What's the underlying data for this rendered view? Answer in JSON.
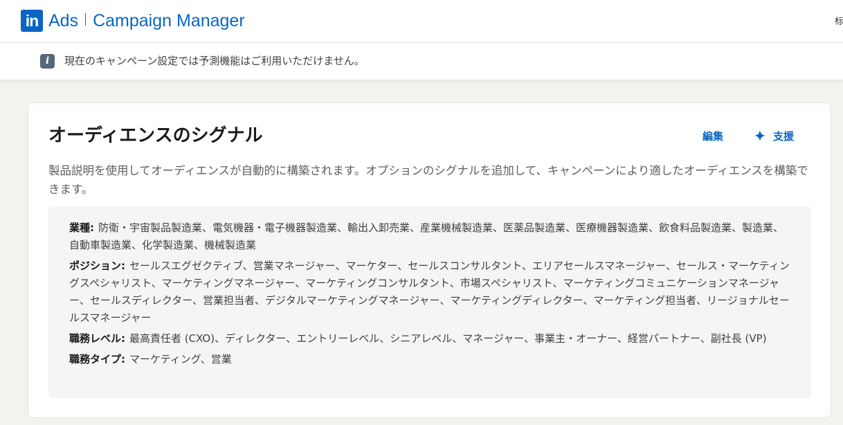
{
  "header": {
    "logo_text": "in",
    "product_part1": "Ads",
    "product_part2": "Campaign Manager",
    "edge_text": "标"
  },
  "notice": {
    "text": "現在のキャンペーン設定では予測機能はご利用いただけません。"
  },
  "card": {
    "title": "オーディエンスのシグナル",
    "edit_label": "編集",
    "assist_label": "支援",
    "description": "製品説明を使用してオーディエンスが自動的に構築されます。オプションのシグナルを追加して、キャンペーンにより適したオーディエンスを構築できます。",
    "signals": [
      {
        "label": "業種:",
        "value": "防衛・宇宙製品製造業、電気機器・電子機器製造業、輸出入卸売業、産業機械製造業、医薬品製造業、医療機器製造業、飲食料品製造業、製造業、自動車製造業、化学製造業、機械製造業"
      },
      {
        "label": "ポジション:",
        "value": "セールスエグゼクティブ、営業マネージャー、マーケター、セールスコンサルタント、エリアセールスマネージャー、セールス・マーケティングスペシャリスト、マーケティングマネージャー、マーケティングコンサルタント、市場スペシャリスト、マーケティングコミュニケーションマネージャー、セールスディレクター、営業担当者、デジタルマーケティングマネージャー、マーケティングディレクター、マーケティング担当者、リージョナルセールスマネージャー"
      },
      {
        "label": "職務レベル:",
        "value": "最高責任者 (CXO)、ディレクター、エントリーレベル、シニアレベル、マネージャー、事業主・オーナー、経営パートナー、副社長 (VP)"
      },
      {
        "label": "職務タイプ:",
        "value": "マーケティング、営業"
      }
    ]
  },
  "colors": {
    "brand_blue": "#0a66c2",
    "page_background": "#f3f2ef",
    "signals_background": "#f4f5f7",
    "info_icon_bg": "#56687a"
  },
  "icons": {
    "logo": "linkedin-logo-icon",
    "notice": "info-icon",
    "assist": "sparkle-icon"
  }
}
